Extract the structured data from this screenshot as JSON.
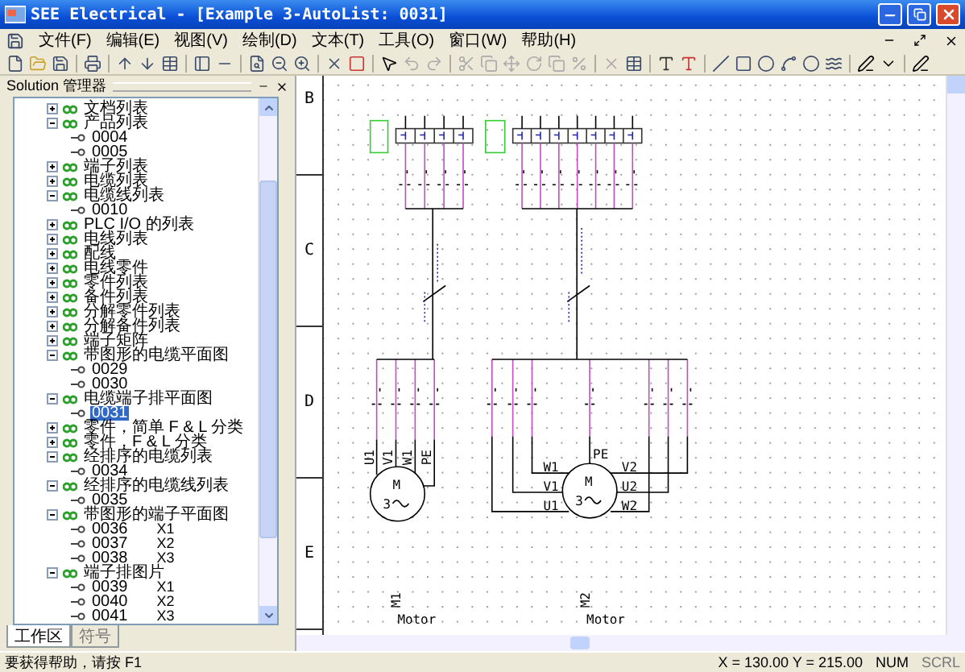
{
  "window": {
    "title": "SEE Electrical - [Example 3-AutoList: 0031]"
  },
  "menu": [
    "文件(F)",
    "编辑(E)",
    "视图(V)",
    "绘制(D)",
    "文本(T)",
    "工具(O)",
    "窗口(W)",
    "帮助(H)"
  ],
  "sidebar": {
    "title": "Solution 管理器",
    "tree": [
      {
        "label": "文档列表",
        "expanded": false
      },
      {
        "label": "产品列表",
        "expanded": true,
        "children": [
          {
            "label": "0004",
            "selected": false
          },
          {
            "label": "0005",
            "selected": false
          }
        ]
      },
      {
        "label": "端子列表",
        "expanded": false
      },
      {
        "label": "电缆列表",
        "expanded": false
      },
      {
        "label": "电缆线列表",
        "expanded": true,
        "children": [
          {
            "label": "0010",
            "selected": false
          }
        ]
      },
      {
        "label": "PLC I/O 的列表",
        "expanded": false
      },
      {
        "label": "电线列表",
        "expanded": false
      },
      {
        "label": "配线",
        "expanded": false
      },
      {
        "label": "电线零件",
        "expanded": false
      },
      {
        "label": "零件列表",
        "expanded": false
      },
      {
        "label": "备件列表",
        "expanded": false
      },
      {
        "label": "分解零件列表",
        "expanded": false
      },
      {
        "label": "分解备件列表",
        "expanded": false
      },
      {
        "label": "端子矩阵",
        "expanded": false
      },
      {
        "label": "带图形的电缆平面图",
        "expanded": true,
        "children": [
          {
            "label": "0029",
            "selected": false
          },
          {
            "label": "0030",
            "selected": false
          }
        ]
      },
      {
        "label": "电缆端子排平面图",
        "expanded": true,
        "children": [
          {
            "label": "0031",
            "selected": true
          }
        ]
      },
      {
        "label": "零件，简单 F & L 分类",
        "expanded": false
      },
      {
        "label": "零件，F & L 分类",
        "expanded": false
      },
      {
        "label": "经排序的电缆列表",
        "expanded": true,
        "children": [
          {
            "label": "0034",
            "selected": false
          }
        ]
      },
      {
        "label": "经排序的电缆线列表",
        "expanded": true,
        "children": [
          {
            "label": "0035",
            "selected": false
          }
        ]
      },
      {
        "label": "带图形的端子平面图",
        "expanded": true,
        "children": [
          {
            "label": "0036",
            "note": "X1",
            "selected": false
          },
          {
            "label": "0037",
            "note": "X2",
            "selected": false
          },
          {
            "label": "0038",
            "note": "X3",
            "selected": false
          }
        ]
      },
      {
        "label": "端子排图片",
        "expanded": true,
        "children": [
          {
            "label": "0039",
            "note": "X1",
            "selected": false
          },
          {
            "label": "0040",
            "note": "X2",
            "selected": false
          },
          {
            "label": "0041",
            "note": "X3",
            "selected": false
          }
        ]
      }
    ],
    "tabs": [
      {
        "label": "工作区",
        "selected": true
      },
      {
        "label": "符号",
        "selected": false
      }
    ]
  },
  "drawing": {
    "rows": [
      "B",
      "C",
      "D",
      "E"
    ],
    "motors": [
      {
        "kind": "single",
        "name": "M1",
        "type": "Motor",
        "symbol": "M",
        "phases": "3",
        "terminals": [
          "U1",
          "V1",
          "W1",
          "PE"
        ]
      },
      {
        "kind": "dual",
        "name": "M2",
        "type": "Motor",
        "symbol": "M",
        "phases": "3",
        "terminals": [
          "W1",
          "V1",
          "U1",
          "PE",
          "V2",
          "U2",
          "W2"
        ]
      }
    ]
  },
  "status_bar": {
    "help": "要获得帮助，请按 F1",
    "coords": "X = 130.00  Y = 215.00",
    "indicators": [
      "NUM",
      "SCRL"
    ]
  }
}
